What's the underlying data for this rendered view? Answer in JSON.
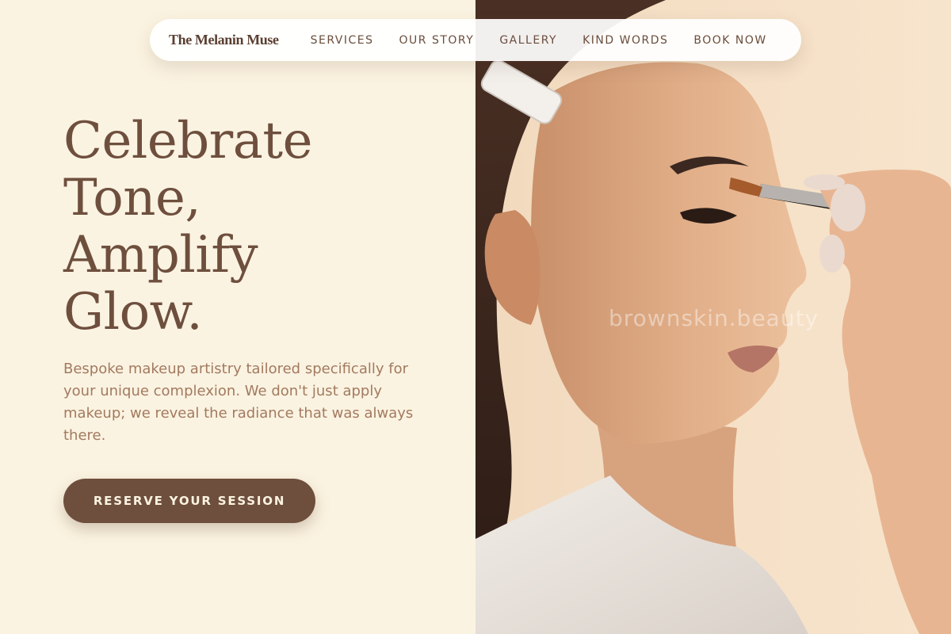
{
  "nav": {
    "brand": "The Melanin Muse",
    "links": [
      {
        "label": "SERVICES"
      },
      {
        "label": "OUR STORY"
      },
      {
        "label": "GALLERY"
      },
      {
        "label": "KIND WORDS"
      },
      {
        "label": "BOOK NOW"
      }
    ]
  },
  "hero": {
    "headline_lines": [
      "Celebrate",
      "Tone,",
      "Amplify",
      "Glow."
    ],
    "subtext": "Bespoke makeup artistry tailored specifically for your unique complexion. We don't just apply makeup; we reveal the radiance that was always there.",
    "cta_label": "RESERVE YOUR SESSION"
  },
  "photo": {
    "watermark": "brownskin.beauty"
  },
  "colors": {
    "background": "#fbf3e1",
    "primary_brown": "#6e4e3c",
    "headline": "#6e4f3e",
    "subtext": "#a27a60",
    "nav_text": "#6a4d3c"
  }
}
